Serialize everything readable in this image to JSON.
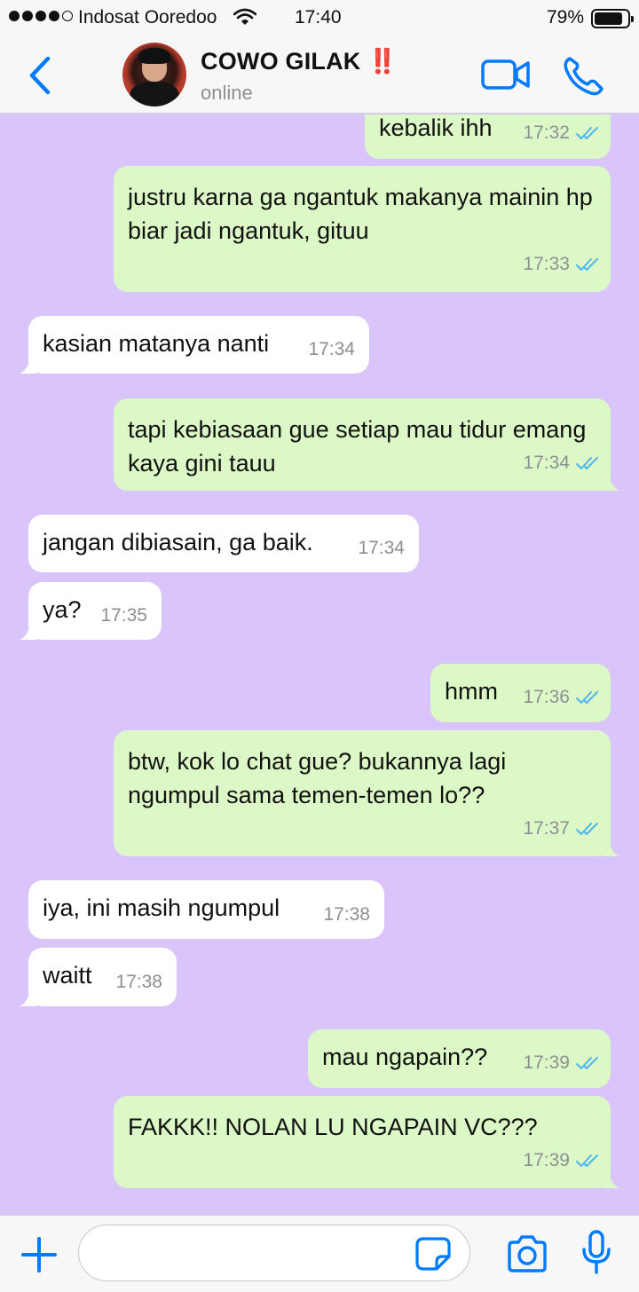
{
  "status_bar": {
    "carrier": "Indosat Ooredoo",
    "time": "17:40",
    "battery": "79%",
    "battery_level": 0.79,
    "signal_bars": 4
  },
  "header": {
    "contact_name": "COWO GILAK",
    "contact_emoji": "‼️",
    "status": "online"
  },
  "colors": {
    "chat_background": "#dac5fb",
    "outgoing_bubble": "#dcf8c6",
    "incoming_bubble": "#ffffff",
    "accent": "#007aff",
    "read_ticks": "#4fb6ec"
  },
  "messages": [
    {
      "dir": "out",
      "text": "kebalik ihh",
      "time": "17:32",
      "read": true
    },
    {
      "dir": "out",
      "text": "justru karna ga ngantuk makanya mainin hp biar jadi ngantuk, gituu",
      "time": "17:33",
      "read": true
    },
    {
      "dir": "in",
      "text": "kasian matanya nanti",
      "time": "17:34"
    },
    {
      "dir": "out",
      "text": "tapi kebiasaan gue setiap mau tidur emang kaya gini tauu",
      "time": "17:34",
      "read": true
    },
    {
      "dir": "in",
      "text": "jangan dibiasain, ga baik.",
      "time": "17:34"
    },
    {
      "dir": "in",
      "text": "ya?",
      "time": "17:35"
    },
    {
      "dir": "out",
      "text": "hmm",
      "time": "17:36",
      "read": true
    },
    {
      "dir": "out",
      "text": "btw, kok lo chat gue? bukannya lagi ngumpul sama temen-temen lo??",
      "time": "17:37",
      "read": true
    },
    {
      "dir": "in",
      "text": "iya, ini masih ngumpul",
      "time": "17:38"
    },
    {
      "dir": "in",
      "text": "waitt",
      "time": "17:38"
    },
    {
      "dir": "out",
      "text": "mau ngapain??",
      "time": "17:39",
      "read": true
    },
    {
      "dir": "out",
      "text": "FAKKK!! NOLAN LU NGAPAIN VC???",
      "time": "17:39",
      "read": true
    }
  ],
  "input": {
    "placeholder": "",
    "value": ""
  },
  "icons": {
    "back": "chevron-left-icon",
    "video": "video-camera-icon",
    "call": "phone-icon",
    "plus": "plus-icon",
    "sticker": "sticker-icon",
    "camera": "camera-icon",
    "mic": "microphone-icon"
  }
}
